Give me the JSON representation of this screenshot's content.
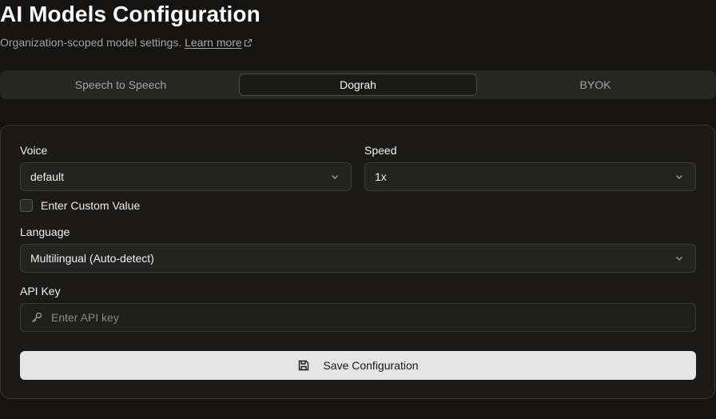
{
  "header": {
    "title": "AI Models Configuration",
    "subtitle": "Organization-scoped model settings.",
    "learn_more": "Learn more"
  },
  "tabs": [
    {
      "label": "Speech to Speech",
      "active": false
    },
    {
      "label": "Dograh",
      "active": true
    },
    {
      "label": "BYOK",
      "active": false
    }
  ],
  "form": {
    "voice": {
      "label": "Voice",
      "value": "default"
    },
    "speed": {
      "label": "Speed",
      "value": "1x"
    },
    "custom_value": {
      "label": "Enter Custom Value",
      "checked": false
    },
    "language": {
      "label": "Language",
      "value": "Multilingual (Auto-detect)"
    },
    "api_key": {
      "label": "API Key",
      "placeholder": "Enter API key",
      "value": ""
    },
    "save_label": "Save Configuration"
  },
  "icons": {
    "external_link": "external-link-icon",
    "chevron": "chevron-down-icon",
    "key": "key-icon",
    "save": "save-icon"
  }
}
